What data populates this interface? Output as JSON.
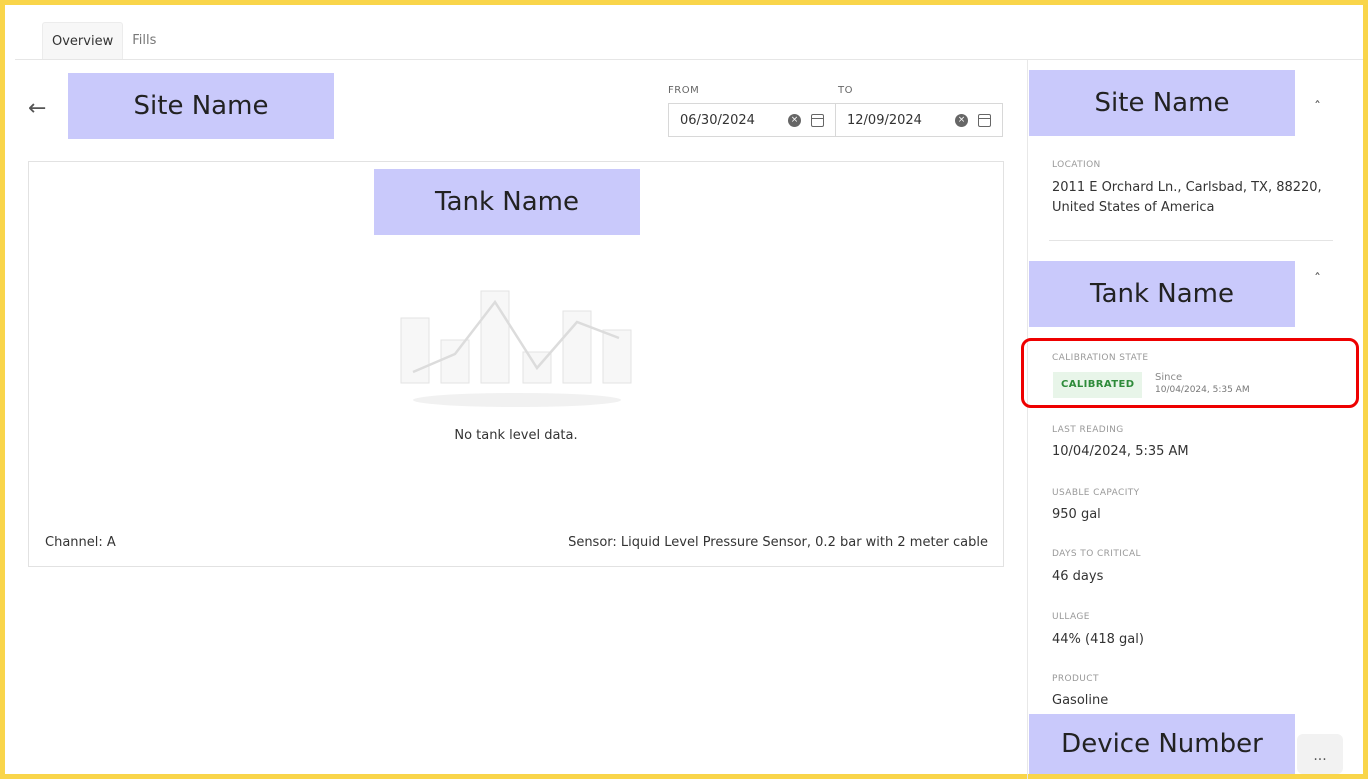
{
  "tabs": [
    {
      "label": "Overview",
      "active": true
    },
    {
      "label": "Fills",
      "active": false
    }
  ],
  "header": {
    "site_name": "Site Name",
    "back_icon": "arrow-left-icon"
  },
  "dates": {
    "from_label": "FROM",
    "from_value": "06/30/2024",
    "to_label": "TO",
    "to_value": "12/09/2024"
  },
  "chart_panel": {
    "tank_name": "Tank Name",
    "empty_message": "No tank level data.",
    "channel": "Channel: A",
    "sensor": "Sensor: Liquid Level Pressure Sensor, 0.2 bar with 2 meter cable"
  },
  "side": {
    "site_name": "Site Name",
    "location_label": "LOCATION",
    "location_line1": "2011 E Orchard Ln., Carlsbad, TX, 88220,",
    "location_line2": "United States of America",
    "tank_name": "Tank Name",
    "calibration_label": "CALIBRATION STATE",
    "calibration_badge": "CALIBRATED",
    "since_label": "Since",
    "since_value": "10/04/2024, 5:35 AM",
    "last_reading_label": "LAST READING",
    "last_reading_value": "10/04/2024, 5:35 AM",
    "usable_capacity_label": "USABLE CAPACITY",
    "usable_capacity_value": "950 gal",
    "days_to_critical_label": "DAYS TO CRITICAL",
    "days_to_critical_value": "46 days",
    "ullage_label": "ULLAGE",
    "ullage_value": "44% (418 gal)",
    "product_label": "PRODUCT",
    "product_value": "Gasoline",
    "device_number": "Device Number",
    "more_label": "..."
  },
  "colors": {
    "frame": "#f9d54a",
    "redaction": "#c9c9fb",
    "calibrated_bg": "#e8f5e9",
    "calibrated_text": "#2e8b3a",
    "highlight": "#ee0000"
  }
}
